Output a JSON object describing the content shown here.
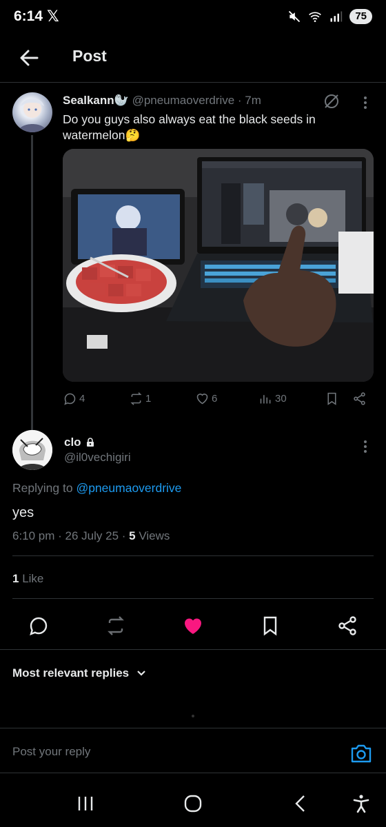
{
  "status_bar": {
    "time": "6:14",
    "app_icon": "x-logo",
    "battery": "75"
  },
  "header": {
    "title": "Post"
  },
  "original_post": {
    "name": "Sealkann🦭",
    "handle": "@pneumaoverdrive",
    "time": "· 7m",
    "text": "Do you guys also always eat the black seeds in watermelon🤔",
    "stats": {
      "replies": "4",
      "reposts": "1",
      "likes": "6",
      "views": "30"
    }
  },
  "reply": {
    "name": "clo",
    "handle": "@il0vechigiri",
    "replying_prefix": "Replying to",
    "replying_to": "@pneumaoverdrive",
    "text": "yes",
    "timestamp": "6:10 pm · 26 July 25 · ",
    "views_count": "5",
    "views_label": " Views",
    "likes_count": "1",
    "likes_label": " Like"
  },
  "sort": {
    "label": "Most relevant replies"
  },
  "composer": {
    "placeholder": "Post your reply"
  },
  "colors": {
    "accent": "#1d9bf0",
    "like": "#f91880",
    "background": "#000000",
    "muted": "#71767b"
  }
}
